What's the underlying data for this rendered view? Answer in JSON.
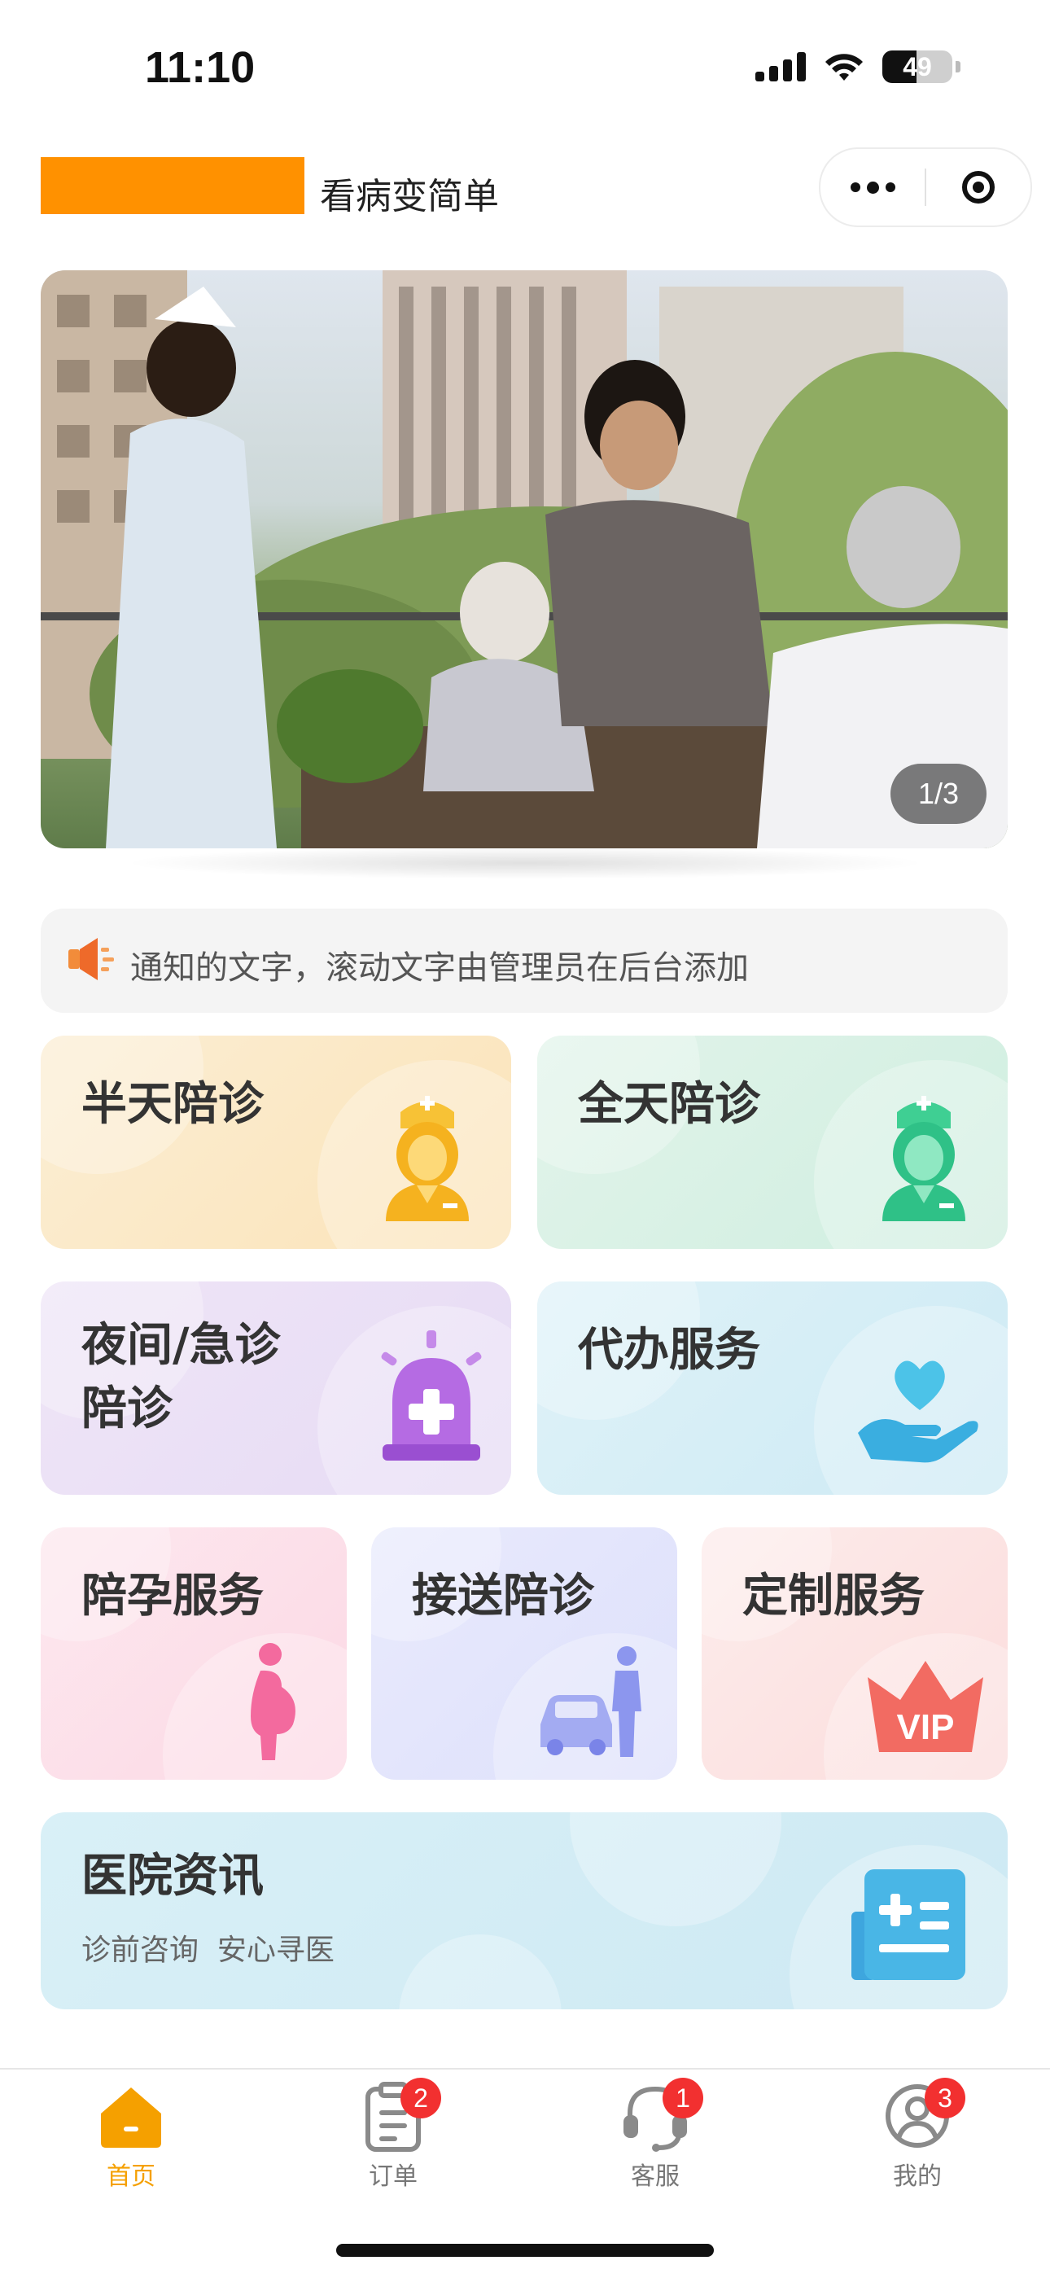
{
  "status_bar": {
    "time": "11:10",
    "battery_level": "49",
    "icons": [
      "signal-icon",
      "wifi-icon",
      "battery-icon"
    ]
  },
  "header": {
    "title": "看病变简单",
    "logo_color": "#ff9100",
    "capsule_icons": [
      "more-icon",
      "close-icon"
    ]
  },
  "banner": {
    "pager": "1/3",
    "image": "banner-photo"
  },
  "notice": {
    "icon": "megaphone-icon",
    "text": "通知的文字，滚动文字由管理员在后台添加"
  },
  "services": [
    {
      "label": "半天陪诊",
      "icon": "nurse-icon",
      "color": "#fbe9c7"
    },
    {
      "label": "全天陪诊",
      "icon": "nurse-icon",
      "color": "#d8f1e5"
    },
    {
      "label": "夜间/急诊陪诊",
      "icon": "alarm-light-icon",
      "color": "#ece2f6"
    },
    {
      "label": "代办服务",
      "icon": "heart-hand-icon",
      "color": "#d9eff6"
    },
    {
      "label": "陪孕服务",
      "icon": "pregnant-woman-icon",
      "color": "#fde1ea"
    },
    {
      "label": "接送陪诊",
      "icon": "car-person-icon",
      "color": "#e4e6fb"
    },
    {
      "label": "定制服务",
      "icon": "vip-crown-icon",
      "color": "#fde5e6"
    }
  ],
  "news": {
    "title": "医院资讯",
    "subtitle": "诊前咨询  安心寻医",
    "icon": "news-document-icon",
    "color": "#d7eef6"
  },
  "tabbar": {
    "active_color": "#f5a000",
    "items": [
      {
        "label": "首页",
        "icon": "home-icon",
        "badge": ""
      },
      {
        "label": "订单",
        "icon": "order-clipboard-icon",
        "badge": "2"
      },
      {
        "label": "客服",
        "icon": "headset-icon",
        "badge": "1"
      },
      {
        "label": "我的",
        "icon": "profile-icon",
        "badge": "3"
      }
    ]
  }
}
